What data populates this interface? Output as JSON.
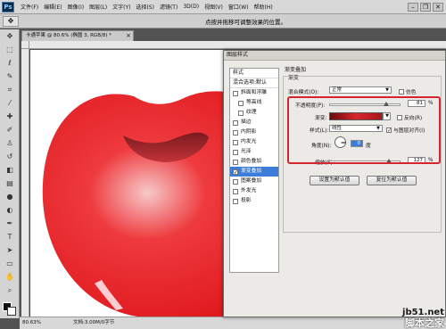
{
  "menubar": {
    "logo": "Ps",
    "items": [
      "文件(F)",
      "编辑(E)",
      "图像(I)",
      "图层(L)",
      "文字(Y)",
      "选择(S)",
      "滤镜(T)",
      "3D(D)",
      "视图(V)",
      "窗口(W)",
      "帮助(H)"
    ],
    "icons": [
      "minimize-icon",
      "restore-icon",
      "close-icon"
    ]
  },
  "options": {
    "tool_icon": "move-tool-icon",
    "hint": "点按并拖移可调整效果的位置。"
  },
  "toolbox": {
    "tools": [
      "move-icon",
      "marquee-icon",
      "lasso-icon",
      "quick-select-icon",
      "crop-icon",
      "eyedropper-icon",
      "healing-icon",
      "brush-icon",
      "stamp-icon",
      "history-brush-icon",
      "eraser-icon",
      "gradient-icon",
      "blur-icon",
      "dodge-icon",
      "pen-icon",
      "type-icon",
      "path-select-icon",
      "shape-icon",
      "hand-icon",
      "zoom-icon"
    ]
  },
  "document": {
    "tab_title": "卡通苹果 @ 80.6% (椭圆 3, RGB/8) *",
    "zoom": "80.63%",
    "doc_info": "文档:3.00M/0字节"
  },
  "watermark": {
    "url": "jb51.net",
    "cn": "脚本之家"
  },
  "dialog": {
    "title": "图层样式",
    "styles_header": "样式",
    "blend_options": "混合选项:默认",
    "items": [
      {
        "label": "斜面和浮雕",
        "checked": false,
        "indent": false,
        "selected": false
      },
      {
        "label": "等高线",
        "checked": false,
        "indent": true,
        "selected": false
      },
      {
        "label": "纹理",
        "checked": false,
        "indent": true,
        "selected": false
      },
      {
        "label": "描边",
        "checked": false,
        "indent": false,
        "selected": false
      },
      {
        "label": "内阴影",
        "checked": false,
        "indent": false,
        "selected": false
      },
      {
        "label": "内发光",
        "checked": false,
        "indent": false,
        "selected": false
      },
      {
        "label": "光泽",
        "checked": false,
        "indent": false,
        "selected": false
      },
      {
        "label": "颜色叠加",
        "checked": false,
        "indent": false,
        "selected": false
      },
      {
        "label": "渐变叠加",
        "checked": true,
        "indent": false,
        "selected": true
      },
      {
        "label": "图案叠加",
        "checked": false,
        "indent": false,
        "selected": false
      },
      {
        "label": "外发光",
        "checked": false,
        "indent": false,
        "selected": false
      },
      {
        "label": "投影",
        "checked": false,
        "indent": false,
        "selected": false
      }
    ],
    "panel_title": "渐变叠加",
    "group_title": "渐变",
    "blend_mode_label": "混合模式(O):",
    "blend_mode_value": "正常",
    "dither_label": "仿色",
    "opacity_label": "不透明度(P):",
    "opacity_value": "81",
    "opacity_unit": "%",
    "opacity_fraction": 0.81,
    "gradient_label": "渐变:",
    "reverse_label": "反向(R)",
    "style_label": "样式(L):",
    "style_value": "线性",
    "align_label": "与图层对齐(I)",
    "align_checked": true,
    "angle_label": "角度(N):",
    "angle_value": "0",
    "angle_unit": "度",
    "scale_label": "缩放(S):",
    "scale_value": "127",
    "scale_unit": "%",
    "scale_fraction": 0.85,
    "default_btn": "设置为默认值",
    "reset_btn": "复位为默认值"
  }
}
